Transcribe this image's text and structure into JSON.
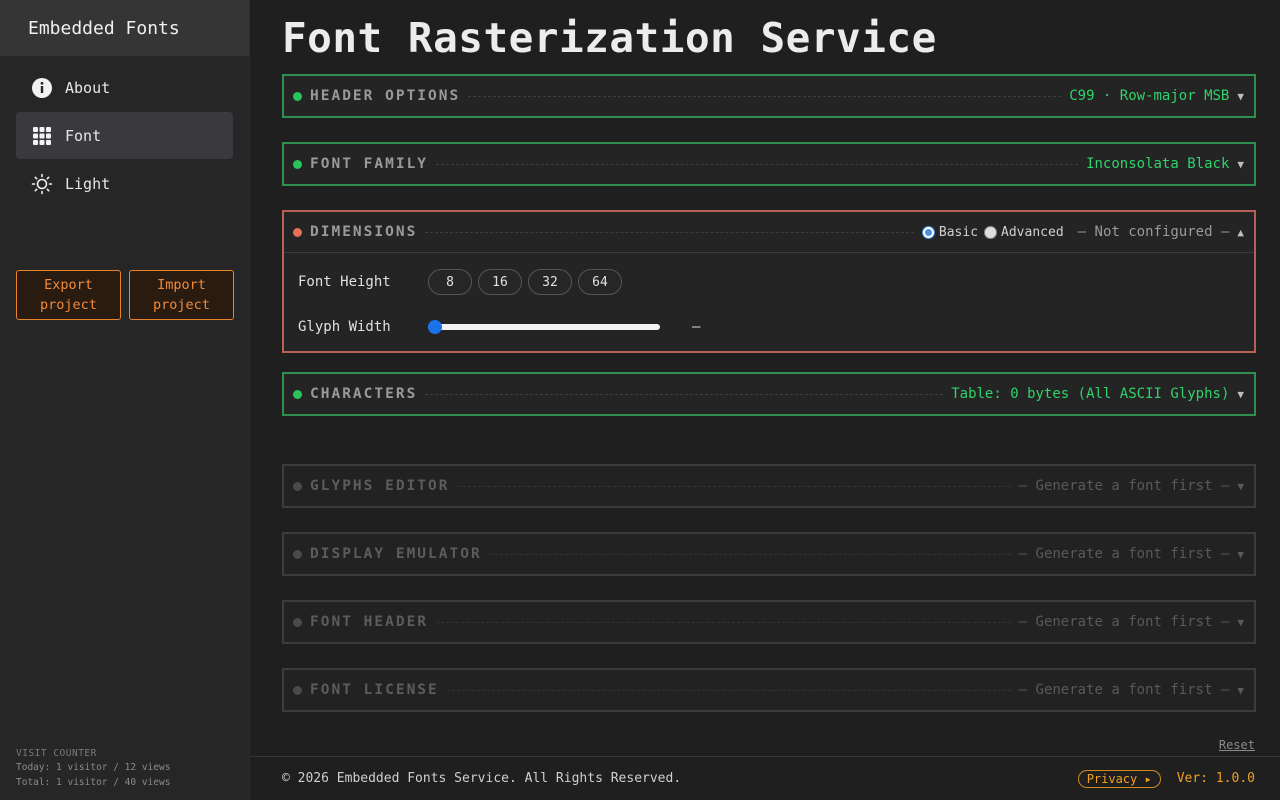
{
  "sidebar": {
    "brand": "Embedded Fonts",
    "items": [
      {
        "label": "About",
        "icon": "info-icon",
        "active": false
      },
      {
        "label": "Font",
        "icon": "grid-icon",
        "active": true
      },
      {
        "label": "Light",
        "icon": "sun-icon",
        "active": false
      }
    ],
    "export_label_1": "Export",
    "export_label_2": "project",
    "import_label_1": "Import",
    "import_label_2": "project",
    "counter": {
      "title": "VISIT COUNTER",
      "today": "Today: 1 visitor / 12 views",
      "total": "Total: 1 visitor / 40 views"
    }
  },
  "main": {
    "title": "Font Rasterization Service",
    "panels": {
      "header_options": {
        "title": "HEADER OPTIONS",
        "status": "C99 · Row-major MSB",
        "caret": "▼"
      },
      "font_family": {
        "title": "FONT FAMILY",
        "status": "Inconsolata Black",
        "caret": "▼"
      },
      "dimensions": {
        "title": "DIMENSIONS",
        "mode_basic": "Basic",
        "mode_advanced": "Advanced",
        "selected_mode": "Basic",
        "status": "— Not configured —",
        "caret": "▲",
        "font_height_label": "Font Height",
        "font_heights": [
          "8",
          "16",
          "32",
          "64"
        ],
        "glyph_width_label": "Glyph Width",
        "glyph_width_value": "—",
        "glyph_width_position": 0
      },
      "characters": {
        "title": "CHARACTERS",
        "status": "Table: 0 bytes (All ASCII Glyphs)",
        "caret": "▼"
      },
      "glyphs_editor": {
        "title": "GLYPHS EDITOR",
        "status": "— Generate a font first —",
        "caret": "▼"
      },
      "display_emulator": {
        "title": "DISPLAY EMULATOR",
        "status": "— Generate a font first —",
        "caret": "▼"
      },
      "font_header": {
        "title": "FONT HEADER",
        "status": "— Generate a font first —",
        "caret": "▼"
      },
      "font_license": {
        "title": "FONT LICENSE",
        "status": "— Generate a font first —",
        "caret": "▼"
      }
    },
    "reset_label": "Reset"
  },
  "footer": {
    "copyright": "© 2026 Embedded Fonts Service. All Rights Reserved.",
    "privacy": "Privacy ▸",
    "version": "Ver: 1.0.0"
  },
  "colors": {
    "ok_border": "#2f8f4e",
    "ok_text": "#2fd36a",
    "warn_border": "#b86055",
    "accent_orange": "#f08a3a",
    "slider_blue": "#1a73e8"
  }
}
